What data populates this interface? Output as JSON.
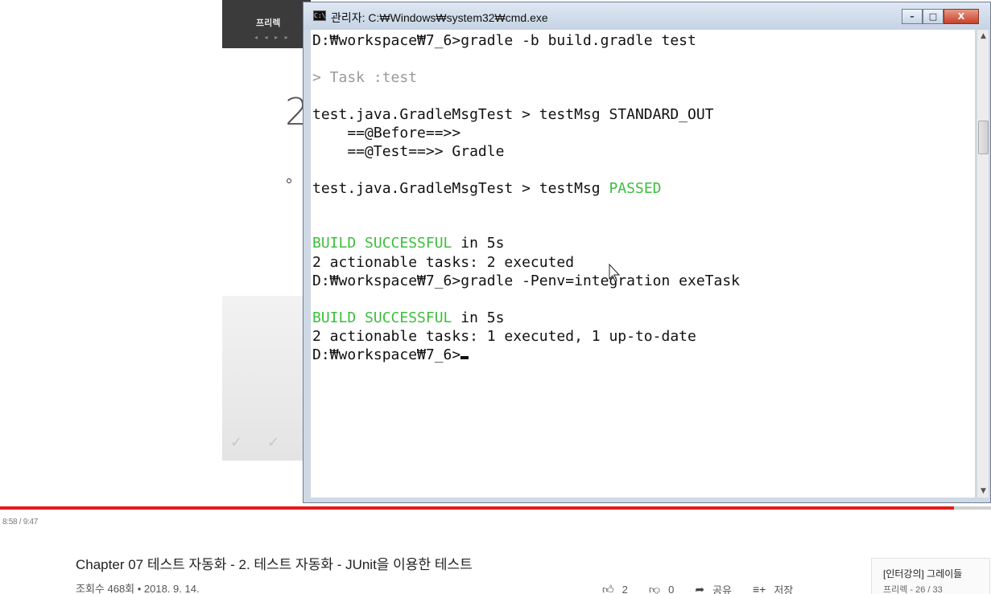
{
  "slide": {
    "brand": "프리렉",
    "big_number": "2"
  },
  "window": {
    "title": "관리자: C:₩Windows₩system32₩cmd.exe",
    "icon_text": "C:\\",
    "minimize": "–",
    "maximize": "□",
    "close": "X"
  },
  "console": {
    "lines": [
      "D:₩workspace₩7_6>gradle -b build.gradle test",
      "> Task :test",
      "test.java.GradleMsgTest > testMsg STANDARD_OUT",
      "    ==@Before==>>",
      "    ==@Test==>> Gradle",
      "test.java.GradleMsgTest > testMsg ",
      "PASSED",
      "BUILD SUCCESSFUL",
      " in 5s",
      "2 actionable tasks: 2 executed",
      "D:₩workspace₩7_6>gradle -Penv=integration exeTask",
      "BUILD SUCCESSFUL",
      " in 5s",
      "2 actionable tasks: 1 executed, 1 up-to-date",
      "D:₩workspace₩7_6>"
    ]
  },
  "player": {
    "timecode": "8:58 / 9:47",
    "progress_fraction": 0.963,
    "progress_color": "#e31b1b"
  },
  "video": {
    "title": "Chapter 07 테스트 자동화 - 2. 테스트 자동화 - JUnit을 이용한 테스트",
    "meta": "조회수 468회 • 2018. 9. 14.",
    "likes": "2",
    "dislikes": "0",
    "share": "공유",
    "save": "저장"
  },
  "playlist": {
    "title": "[인터강의] 그레이들",
    "sub": "프리렉 - 26 / 33"
  },
  "colors": {
    "console_green": "#3cbf3c",
    "console_dim": "#9a9a9a",
    "titlebar": "#c5d3e4"
  }
}
